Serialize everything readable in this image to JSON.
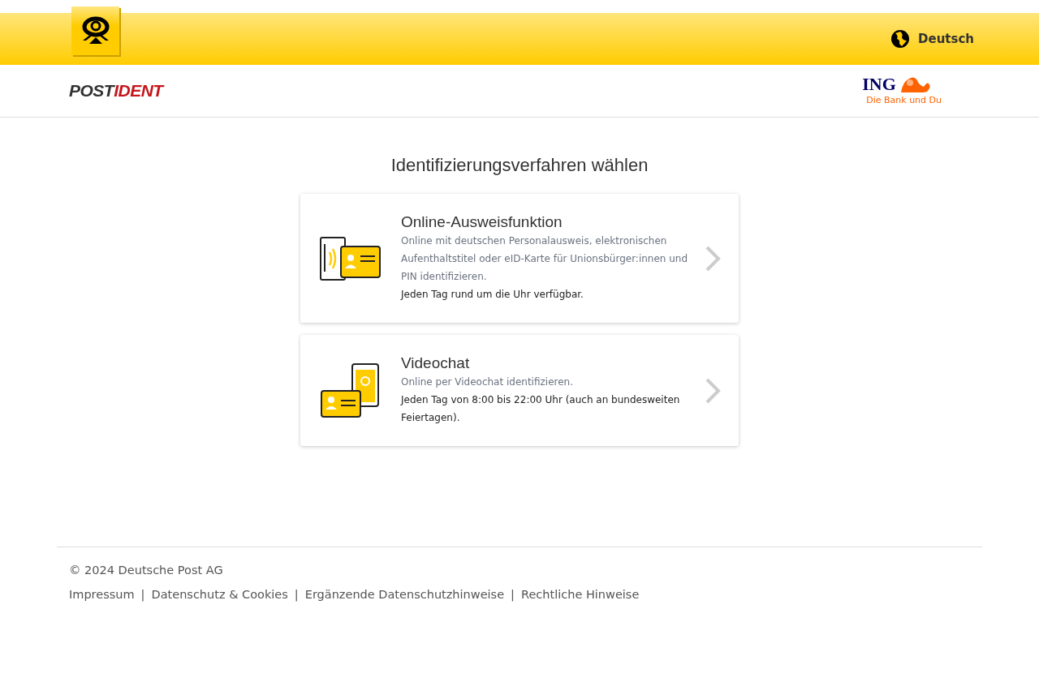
{
  "header": {
    "language": "Deutsch"
  },
  "brand_bar": {
    "postident": {
      "part_1": "POST",
      "part_2": "IDENT"
    },
    "partner": {
      "name": "ING",
      "slogan": "Die Bank und Du"
    }
  },
  "main": {
    "title": "Identifizierungsverfahren wählen",
    "options": [
      {
        "kind": "eid",
        "title": "Online-Ausweisfunktion",
        "description": "Online mit deutschen Personalausweis, elektronischen Aufenthaltstitel oder eID-Karte für Unionsbürger:innen und PIN identifizieren.",
        "availability": "Jeden Tag rund um die Uhr verfügbar."
      },
      {
        "kind": "video",
        "title": "Videochat",
        "description": "Online per Videochat identifizieren.",
        "availability": "Jeden Tag von 8:00 bis 22:00 Uhr (auch an bundesweiten Feiertagen)."
      }
    ]
  },
  "footer": {
    "copyright": "© 2024 Deutsche Post AG",
    "links": [
      {
        "label": "Impressum",
        "separator": "|"
      },
      {
        "label": "Datenschutz & Cookies",
        "separator": "|"
      },
      {
        "label": "Ergänzende Datenschutzhinweise",
        "separator": "|"
      },
      {
        "label": "Rechtliche Hinweise"
      }
    ]
  }
}
